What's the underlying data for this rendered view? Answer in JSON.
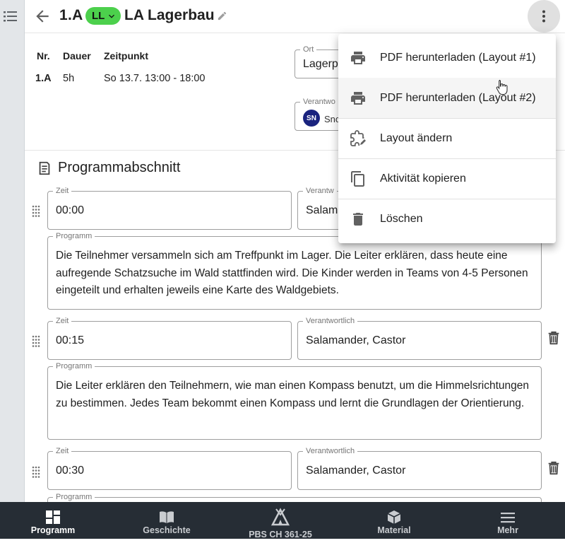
{
  "header": {
    "number": "1.A",
    "category_short": "LL",
    "title": "LA Lagerbau"
  },
  "info": {
    "col_nr": "Nr.",
    "col_duration": "Dauer",
    "col_time": "Zeitpunkt",
    "nr": "1.A",
    "duration": "5h",
    "time": "So 13.7. 13:00 - 18:00"
  },
  "location": {
    "label": "Ort",
    "value": "Lagerp"
  },
  "responsible": {
    "label": "Verantwo",
    "avatar_initials": "SN",
    "name_partial": "Sno"
  },
  "section": {
    "title": "Programmabschnitt"
  },
  "program_blocks": [
    {
      "time_label": "Zeit",
      "time": "00:00",
      "responsible_label": "Verantw",
      "responsible": "Salam",
      "program_label": "Programm",
      "program": "Die Teilnehmer versammeln sich am Treffpunkt im Lager. Die Leiter erklären, dass heute eine aufregende Schatzsuche im Wald stattfinden wird. Die Kinder werden in Teams von 4-5 Personen eingeteilt und erhalten jeweils eine Karte des Waldgebiets."
    },
    {
      "time_label": "Zeit",
      "time": "00:15",
      "responsible_label": "Verantwortlich",
      "responsible": "Salamander, Castor",
      "program_label": "Programm",
      "program": "Die Leiter erklären den Teilnehmern, wie man einen Kompass benutzt, um die Himmelsrichtungen zu bestimmen. Jedes Team bekommt einen Kompass und lernt die Grundlagen der Orientierung."
    },
    {
      "time_label": "Zeit",
      "time": "00:30",
      "responsible_label": "Verantwortlich",
      "responsible": "Salamander, Castor",
      "program_label": "Programm",
      "program": ""
    }
  ],
  "context_menu": {
    "items": [
      {
        "label": "PDF herunterladen (Layout #1)",
        "icon": "printer-icon"
      },
      {
        "label": "PDF herunterladen (Layout #2)",
        "icon": "printer-icon"
      },
      {
        "label": "Layout ändern",
        "icon": "puzzle-edit-icon"
      },
      {
        "label": "Aktivität kopieren",
        "icon": "copy-icon"
      },
      {
        "label": "Löschen",
        "icon": "trash-icon"
      }
    ]
  },
  "bottom_nav": {
    "items": [
      {
        "label": "Programm",
        "icon": "dashboard-icon",
        "active": true
      },
      {
        "label": "Geschichte",
        "icon": "book-icon",
        "active": false
      },
      {
        "label": "PBS CH 361-25",
        "icon": "camp-tent-icon",
        "active": false
      },
      {
        "label": "Material",
        "icon": "package-icon",
        "active": false
      },
      {
        "label": "Mehr",
        "icon": "menu-icon",
        "active": false
      }
    ]
  },
  "colors": {
    "category_chip": "#4cd04c",
    "bottom_nav_bg": "#262d35",
    "avatar_bg": "#1a237e",
    "left_rail_bg": "#e3e6e9"
  }
}
